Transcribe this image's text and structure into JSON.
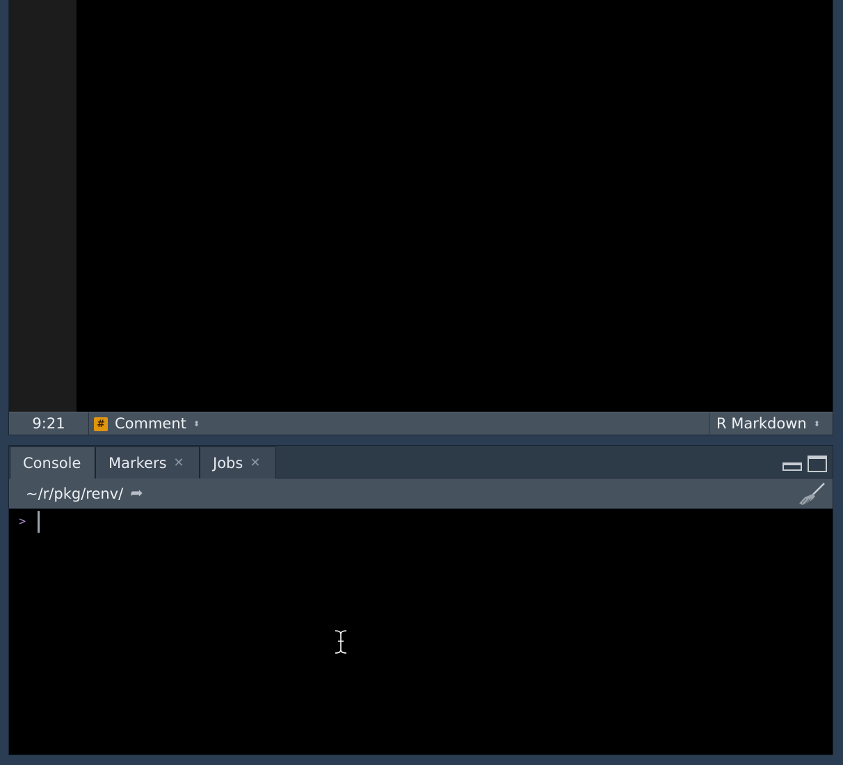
{
  "editor": {
    "status": {
      "cursor_position": "9:21",
      "scope_badge": "#",
      "scope_label": "Comment",
      "doc_type": "R Markdown",
      "updown_glyph": "⬍"
    }
  },
  "console": {
    "tabs": [
      {
        "label": "Console",
        "active": true
      },
      {
        "label": "Markers",
        "closable": true
      },
      {
        "label": "Jobs",
        "closable": true
      }
    ],
    "close_glyph": "✕",
    "working_dir": "~/r/pkg/renv/",
    "goto_glyph": "➦",
    "prompt": ">"
  },
  "colors": {
    "scope_badge": "#e0950e",
    "prompt": "#a98ccf",
    "bar": "#46525e"
  }
}
